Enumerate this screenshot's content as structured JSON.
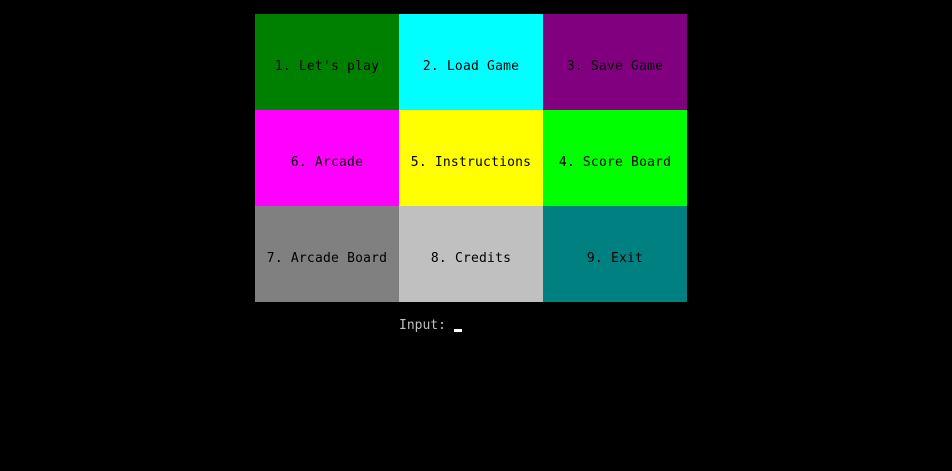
{
  "menu": {
    "items": [
      {
        "label": "1. Let's play",
        "color": "#008000"
      },
      {
        "label": "2. Load Game",
        "color": "#00ffff"
      },
      {
        "label": "3. Save Game",
        "color": "#800080"
      },
      {
        "label": "6. Arcade",
        "color": "#ff00ff"
      },
      {
        "label": "5. Instructions",
        "color": "#ffff00"
      },
      {
        "label": "4. Score Board",
        "color": "#00ff00"
      },
      {
        "label": "7. Arcade Board",
        "color": "#808080"
      },
      {
        "label": "8. Credits",
        "color": "#c0c0c0"
      },
      {
        "label": "9. Exit",
        "color": "#008080"
      }
    ]
  },
  "prompt": {
    "label": "Input:",
    "value": ""
  },
  "colors": {
    "background": "#000000",
    "text": "#000000",
    "prompt_text": "#c0c0c0",
    "cursor": "#ffffff"
  }
}
